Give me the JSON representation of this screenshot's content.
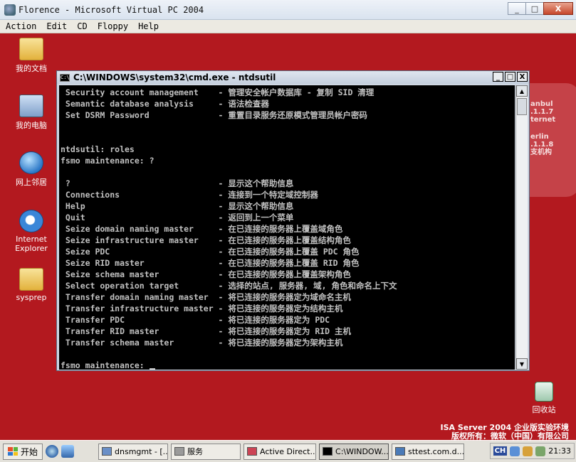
{
  "host": {
    "title": "Florence - Microsoft Virtual PC 2004",
    "controls": [
      "_",
      "□",
      "X"
    ],
    "menu": [
      "Action",
      "Edit",
      "CD",
      "Floppy",
      "Help"
    ]
  },
  "desktop": {
    "icons": [
      {
        "label": "我的文档",
        "icon": "folder-icon"
      },
      {
        "label": "我的电脑",
        "icon": "computer-icon"
      },
      {
        "label": "网上邻居",
        "icon": "network-icon"
      },
      {
        "label": "Internet Explorer",
        "icon": "ie-icon"
      },
      {
        "label": "sysprep",
        "icon": "folder-icon"
      }
    ],
    "recycle_bin": "回收站",
    "network_labels": [
      "anbul",
      ".1.1.7",
      "ternet",
      "erlin",
      ".1.1.8",
      "支机构"
    ],
    "isa_line1": "ISA Server 2004 企业版实验环境",
    "isa_line2": "版权所有：微软（中国）有限公司"
  },
  "cmd": {
    "title": "C:\\WINDOWS\\system32\\cmd.exe - ntdsutil",
    "controls": [
      "_",
      "□",
      "X"
    ],
    "lines": [
      " Security account management    - 管理安全帐户数据库 - 复制 SID 清理",
      " Semantic database analysis     - 语法检查器",
      " Set DSRM Password              - 重置目录服务还原模式管理员帐户密码",
      "",
      "",
      "ntdsutil: roles",
      "fsmo maintenance: ?",
      "",
      " ?                              - 显示这个帮助信息",
      " Connections                    - 连接到一个特定域控制器",
      " Help                           - 显示这个帮助信息",
      " Quit                           - 返回到上一个菜单",
      " Seize domain naming master     - 在已连接的服务器上覆盖域角色",
      " Seize infrastructure master    - 在已连接的服务器上覆盖结构角色",
      " Seize PDC                      - 在已连接的服务器上覆盖 PDC 角色",
      " Seize RID master               - 在已连接的服务器上覆盖 RID 角色",
      " Seize schema master            - 在已连接的服务器上覆盖架构角色",
      " Select operation target        - 选择的站点, 服务器, 域, 角色和命名上下文",
      " Transfer domain naming master  - 将已连接的服务器定为域命名主机",
      " Transfer infrastructure master - 将已连接的服务器定为结构主机",
      " Transfer PDC                   - 将已连接的服务器定为 PDC",
      " Transfer RID master            - 将已连接的服务器定为 RID 主机",
      " Transfer schema master         - 将已连接的服务器定为架构主机",
      "",
      "fsmo maintenance: "
    ]
  },
  "taskbar": {
    "start": "开始",
    "tasks": [
      {
        "label": "dnsmgmt - [...",
        "active": false
      },
      {
        "label": "服务",
        "active": false
      },
      {
        "label": "Active Direct...",
        "active": false
      },
      {
        "label": "C:\\WINDOW...",
        "active": true
      },
      {
        "label": "sttest.com.d...",
        "active": false
      }
    ],
    "lang": "CH",
    "clock": "21:33"
  },
  "colors": {
    "desktop": "#b3191f",
    "console_bg": "#000000",
    "console_text": "#c0c0c0"
  }
}
